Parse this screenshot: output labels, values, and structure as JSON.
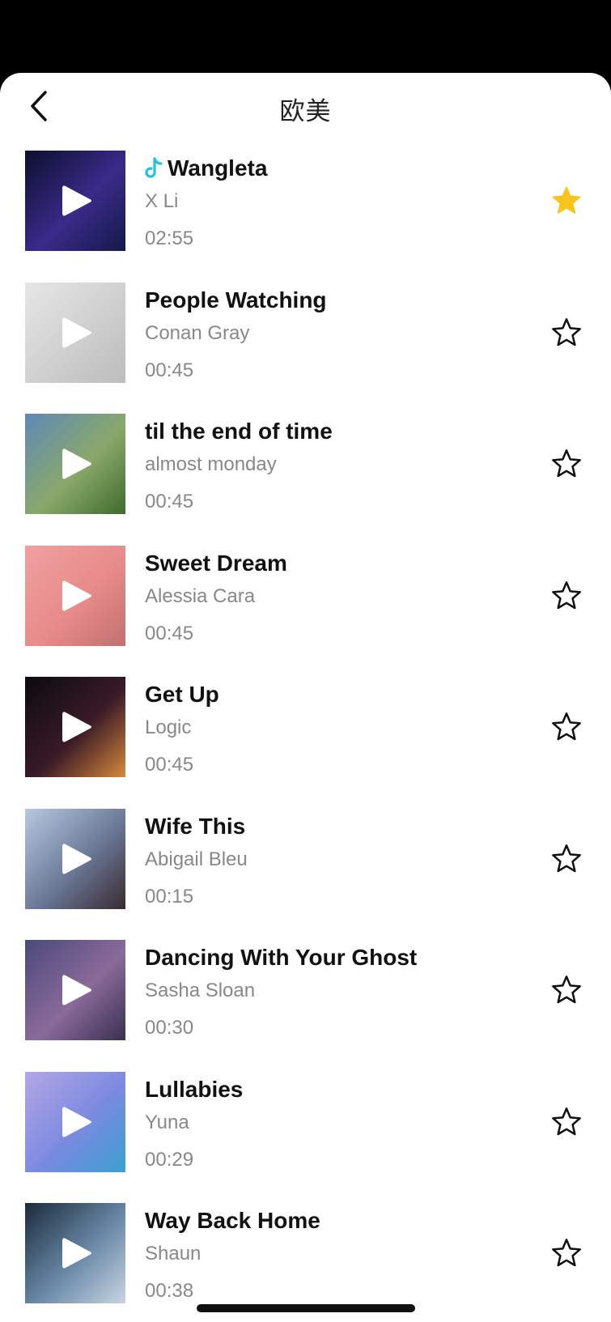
{
  "header": {
    "title": "欧美",
    "back_icon": "chevron-left-icon"
  },
  "colors": {
    "star_active": "#f7c51e",
    "star_inactive": "#111111",
    "tiktok_cyan": "#25c2d8"
  },
  "songs": [
    {
      "title": "Wangleta",
      "artist": "X Li",
      "duration": "02:55",
      "favorited": true,
      "tiktok": true,
      "art": [
        "#0b0f2e",
        "#3b2a8a",
        "#131a4a"
      ]
    },
    {
      "title": "People Watching",
      "artist": "Conan Gray",
      "duration": "00:45",
      "favorited": false,
      "tiktok": false,
      "art": [
        "#e6e6e6",
        "#cfcfcf",
        "#bdbdbd"
      ]
    },
    {
      "title": "til the end of time",
      "artist": "almost monday",
      "duration": "00:45",
      "favorited": false,
      "tiktok": false,
      "art": [
        "#5d88b8",
        "#8aa86a",
        "#3e6b2e"
      ]
    },
    {
      "title": "Sweet Dream",
      "artist": "Alessia Cara",
      "duration": "00:45",
      "favorited": false,
      "tiktok": false,
      "art": [
        "#f0a0a0",
        "#e88b8b",
        "#c27070"
      ]
    },
    {
      "title": "Get Up",
      "artist": "Logic",
      "duration": "00:45",
      "favorited": false,
      "tiktok": false,
      "art": [
        "#0b0b10",
        "#3a1a28",
        "#d88a3a"
      ]
    },
    {
      "title": "Wife This",
      "artist": "Abigail Bleu",
      "duration": "00:15",
      "favorited": false,
      "tiktok": false,
      "art": [
        "#b8c8e0",
        "#6a7896",
        "#3a2a30"
      ]
    },
    {
      "title": "Dancing With Your Ghost",
      "artist": "Sasha Sloan",
      "duration": "00:30",
      "favorited": false,
      "tiktok": false,
      "art": [
        "#4a4a7a",
        "#8a6a9a",
        "#3a3050"
      ]
    },
    {
      "title": "Lullabies",
      "artist": "Yuna",
      "duration": "00:29",
      "favorited": false,
      "tiktok": false,
      "art": [
        "#b4a6e6",
        "#7a8ae0",
        "#3aa0d0"
      ]
    },
    {
      "title": "Way Back Home",
      "artist": "Shaun",
      "duration": "00:38",
      "favorited": false,
      "tiktok": false,
      "art": [
        "#1a2a3a",
        "#6a8aa8",
        "#c8d4e0"
      ]
    }
  ]
}
